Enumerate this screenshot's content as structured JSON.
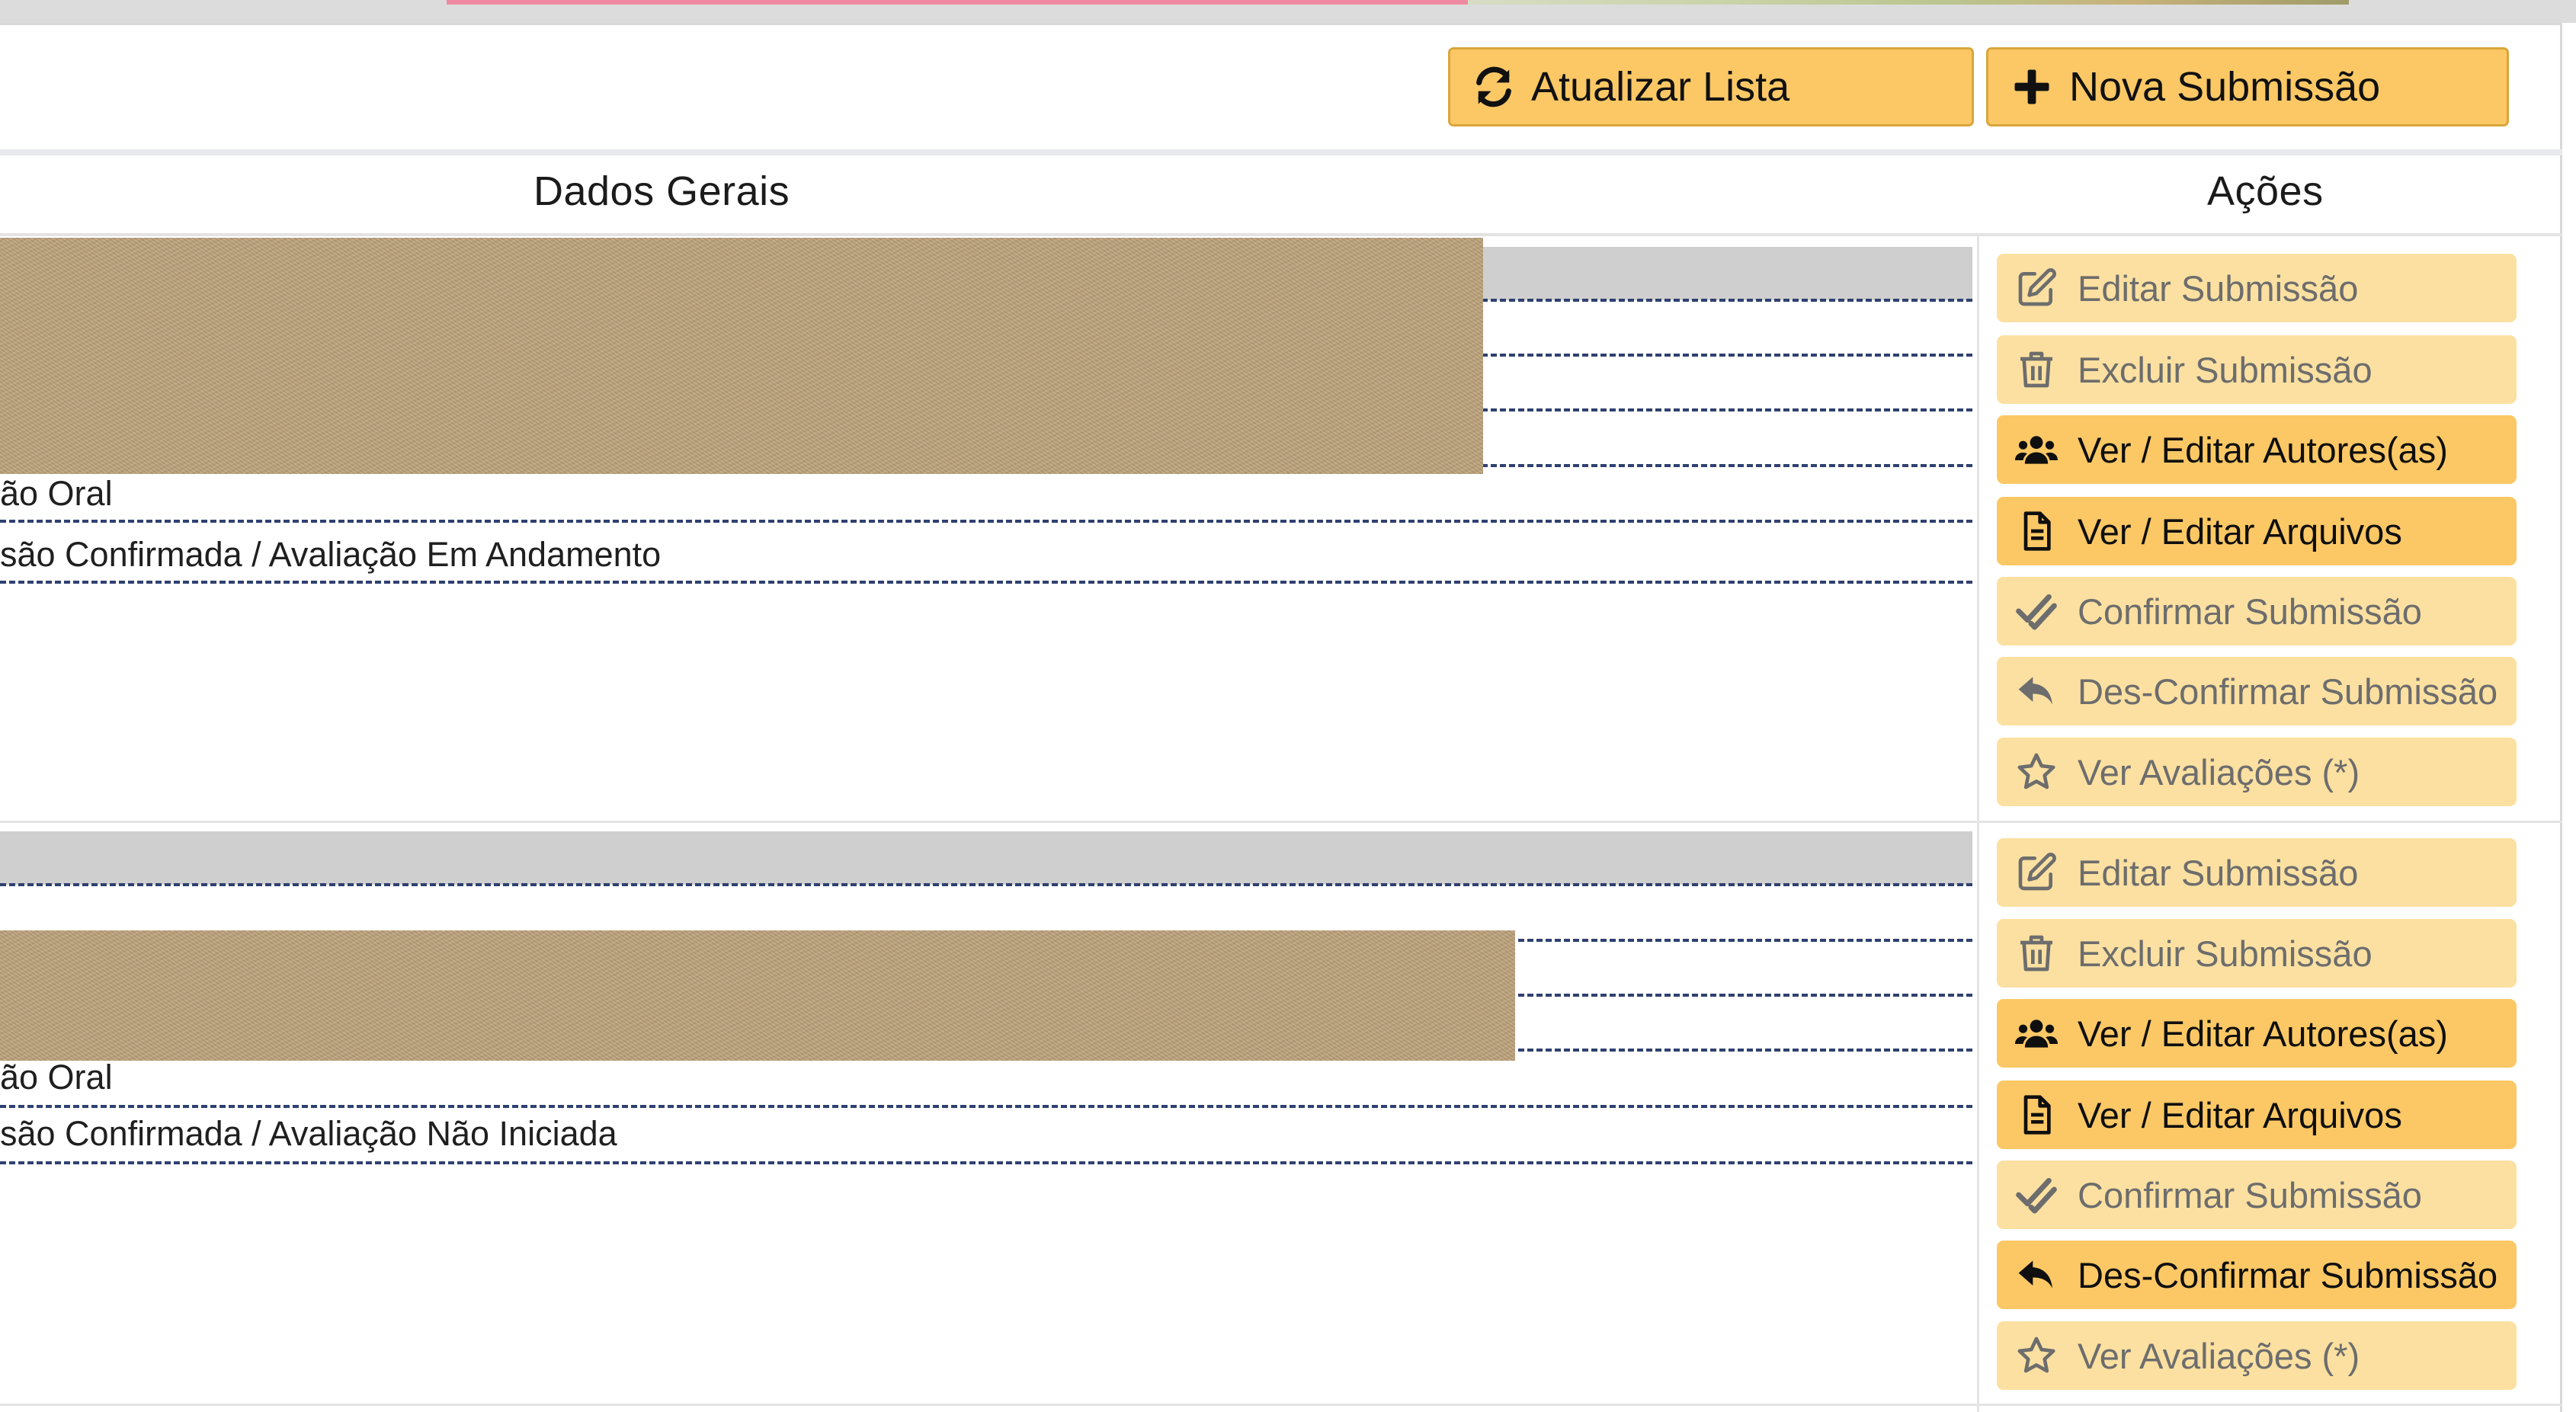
{
  "toolbar": {
    "refresh_label": "Atualizar Lista",
    "new_label": "Nova Submissão"
  },
  "table": {
    "col_general": "Dados Gerais",
    "col_actions": "Ações"
  },
  "submissions": [
    {
      "type_fragment": "ão Oral",
      "status_fragment": "são Confirmada / Avaliação Em Andamento",
      "actions": [
        {
          "label": "Editar Submissão",
          "icon": "edit-icon",
          "enabled": false
        },
        {
          "label": "Excluir Submissão",
          "icon": "trash-icon",
          "enabled": false
        },
        {
          "label": "Ver / Editar Autores(as)",
          "icon": "users-icon",
          "enabled": true
        },
        {
          "label": "Ver / Editar Arquivos",
          "icon": "file-icon",
          "enabled": true
        },
        {
          "label": "Confirmar Submissão",
          "icon": "double-check-icon",
          "enabled": false
        },
        {
          "label": "Des-Confirmar Submissão",
          "icon": "reply-icon",
          "enabled": false
        },
        {
          "label": "Ver Avaliações (*)",
          "icon": "star-icon",
          "enabled": false
        }
      ]
    },
    {
      "type_fragment": "ão Oral",
      "status_fragment": "são Confirmada / Avaliação Não Iniciada",
      "actions": [
        {
          "label": "Editar Submissão",
          "icon": "edit-icon",
          "enabled": false
        },
        {
          "label": "Excluir Submissão",
          "icon": "trash-icon",
          "enabled": false
        },
        {
          "label": "Ver / Editar Autores(as)",
          "icon": "users-icon",
          "enabled": true
        },
        {
          "label": "Ver / Editar Arquivos",
          "icon": "file-icon",
          "enabled": true
        },
        {
          "label": "Confirmar Submissão",
          "icon": "double-check-icon",
          "enabled": false
        },
        {
          "label": "Des-Confirmar Submissão",
          "icon": "reply-icon",
          "enabled": true
        },
        {
          "label": "Ver Avaliações (*)",
          "icon": "star-icon",
          "enabled": false
        }
      ]
    }
  ],
  "colors": {
    "button_active": "#fbc865",
    "button_disabled": "#fbe0a1",
    "dashed_rule": "#2f4170"
  }
}
